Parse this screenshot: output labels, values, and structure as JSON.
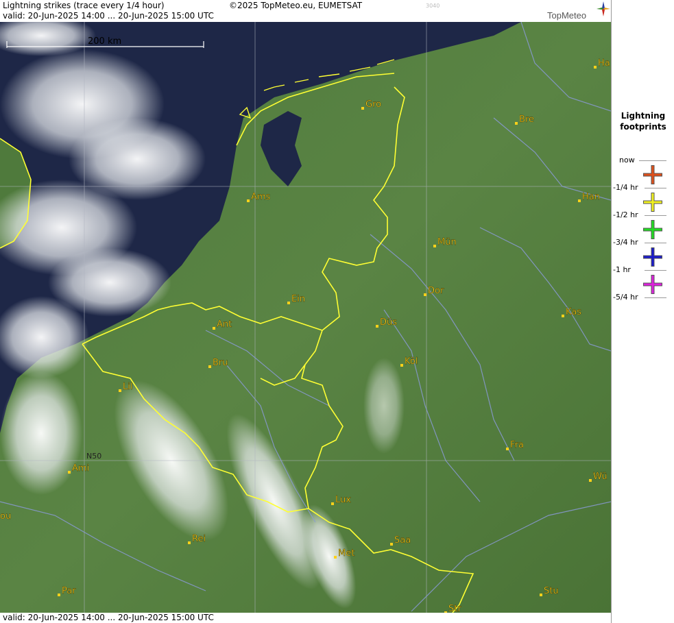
{
  "header": {
    "title": "Lightning strikes (trace every 1/4 hour)",
    "valid": "valid:  20-Jun-2025 14:00 ... 20-Jun-2025 15:00 UTC",
    "copyright": "©2025 TopMeteo.eu, EUMETSAT",
    "code": "3040"
  },
  "logo": {
    "text": "TopMeteo"
  },
  "footer": {
    "valid": "valid:  20-Jun-2025 14:00 ... 20-Jun-2025 15:00 UTC"
  },
  "map": {
    "scale_label": "200 km",
    "latitude_label": "N50",
    "colors": {
      "border": "#ffff33",
      "river": "#8a9ad6",
      "grid": "#b0b4c0",
      "city_label": "#ffd11a"
    },
    "cities": [
      {
        "name": "Ha"
      },
      {
        "name": "Gro"
      },
      {
        "name": "Bre"
      },
      {
        "name": "Ams"
      },
      {
        "name": "Han"
      },
      {
        "name": "Mün"
      },
      {
        "name": "Ein"
      },
      {
        "name": "Dor"
      },
      {
        "name": "Ant"
      },
      {
        "name": "Düs"
      },
      {
        "name": "Kas"
      },
      {
        "name": "Bru"
      },
      {
        "name": "Köl"
      },
      {
        "name": "Lil"
      },
      {
        "name": "Fra"
      },
      {
        "name": "Ami"
      },
      {
        "name": "Wü"
      },
      {
        "name": "Lux"
      },
      {
        "name": "ou"
      },
      {
        "name": "Rei"
      },
      {
        "name": "Saa"
      },
      {
        "name": "Met"
      },
      {
        "name": "Par"
      },
      {
        "name": "Stu"
      },
      {
        "name": "Str"
      }
    ]
  },
  "legend": {
    "title_line1": "Lightning",
    "title_line2": "footprints",
    "entries": [
      {
        "label": "now",
        "color": "#e0501a"
      },
      {
        "label": "-1/4 hr",
        "color": "#f0f020"
      },
      {
        "label": "-1/2 hr",
        "color": "#22dd22"
      },
      {
        "label": "-3/4 hr",
        "color": "#1a1acc"
      },
      {
        "label": "-1 hr",
        "color": "#dd22dd"
      },
      {
        "label": "-5/4 hr",
        "color": ""
      }
    ]
  }
}
